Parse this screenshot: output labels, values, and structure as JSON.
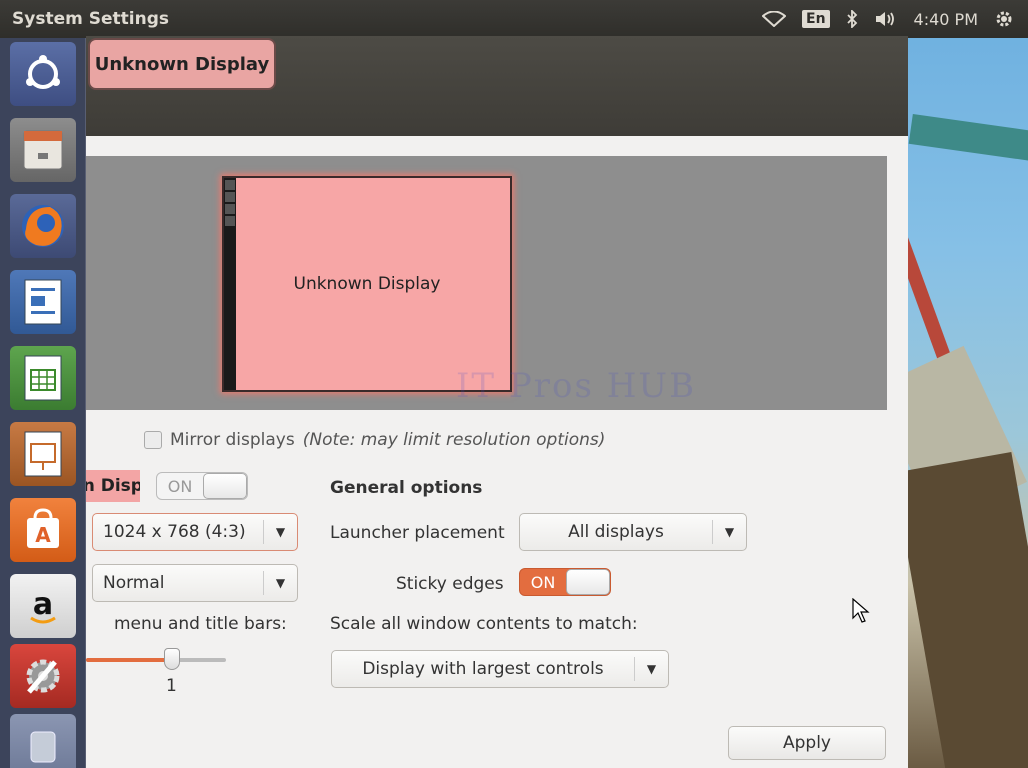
{
  "panel": {
    "app_title": "System Settings",
    "language": "En",
    "clock": "4:40 PM"
  },
  "window": {
    "display_tab": "Unknown Display",
    "monitor_label": "Unknown Display",
    "watermark": "IT Pros HUB",
    "mirror_label": "Mirror displays",
    "mirror_note": "(Note: may limit resolution options)",
    "display_name": "Unknown Display",
    "display_toggle": "ON",
    "resolution": "1024 x 768 (4:3)",
    "rotation": "Normal",
    "scale_label": "menu and title bars:",
    "scale_value": "1",
    "scale_level": 0.5,
    "general_heading": "General options",
    "launcher_placement_label": "Launcher placement",
    "launcher_placement_value": "All displays",
    "sticky_edges_label": "Sticky edges",
    "sticky_edges_toggle": "ON",
    "scale_all_label": "Scale all window contents to match:",
    "scale_all_value": "Display with largest controls",
    "apply_label": "Apply"
  },
  "colors": {
    "accent": "#e36d3f",
    "display_pink": "#f7a6a6",
    "launcher_bg": "#3e465f"
  }
}
